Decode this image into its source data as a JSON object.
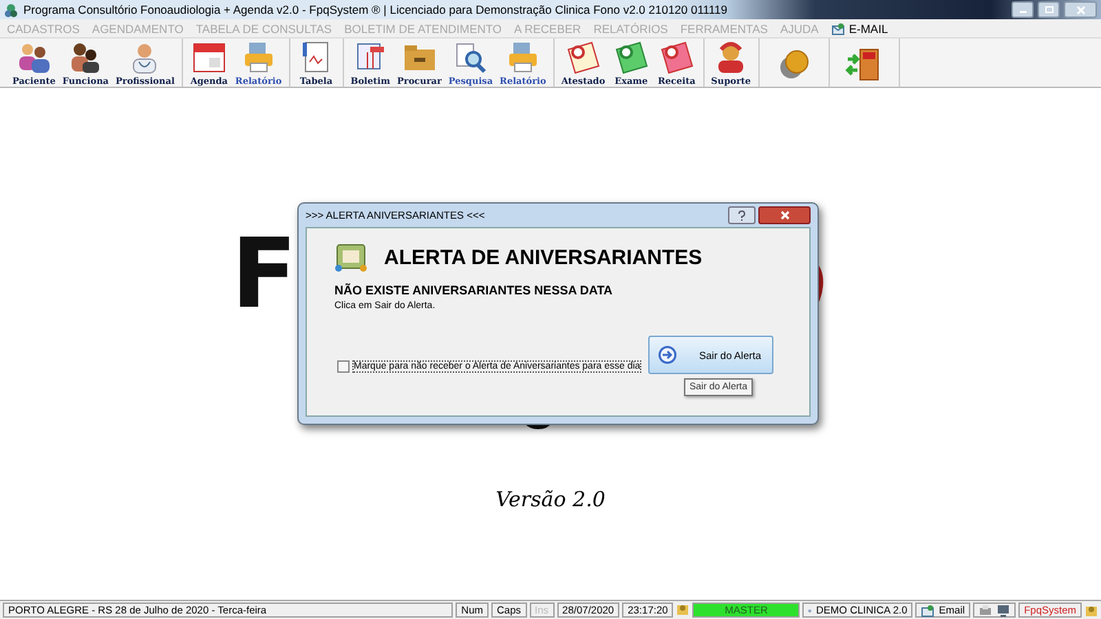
{
  "window": {
    "title": "Programa Consultório Fonoaudiologia + Agenda v2.0 - FpqSystem ® | Licenciado para  Demonstração Clinica Fono v2.0 210120 011119"
  },
  "menu": [
    {
      "label": "CADASTROS",
      "disabled": true
    },
    {
      "label": "AGENDAMENTO",
      "disabled": true
    },
    {
      "label": "TABELA DE CONSULTAS",
      "disabled": true
    },
    {
      "label": "BOLETIM DE ATENDIMENTO",
      "disabled": true
    },
    {
      "label": "A RECEBER",
      "disabled": true
    },
    {
      "label": "RELATÓRIOS",
      "disabled": true
    },
    {
      "label": "FERRAMENTAS",
      "disabled": true
    },
    {
      "label": "AJUDA",
      "disabled": true
    },
    {
      "label": "E-MAIL",
      "disabled": false
    }
  ],
  "toolbar": [
    [
      {
        "label": "Paciente",
        "color": "#10204a"
      },
      {
        "label": "Funciona",
        "color": "#10204a"
      },
      {
        "label": "Profissional",
        "color": "#10204a"
      }
    ],
    [
      {
        "label": "Agenda",
        "color": "#10204a"
      },
      {
        "label": "Relatório",
        "color": "#3050b0"
      }
    ],
    [
      {
        "label": "Tabela",
        "color": "#10204a"
      }
    ],
    [
      {
        "label": "Boletim",
        "color": "#10204a"
      },
      {
        "label": "Procurar",
        "color": "#10204a"
      },
      {
        "label": "Pesquisa",
        "color": "#3050b0"
      },
      {
        "label": "Relatório",
        "color": "#3050b0"
      }
    ],
    [
      {
        "label": "Atestado",
        "color": "#10204a"
      },
      {
        "label": "Exame",
        "color": "#10204a"
      },
      {
        "label": "Receita",
        "color": "#10204a"
      }
    ],
    [
      {
        "label": "Suporte",
        "color": "#10204a"
      }
    ],
    [
      {
        "kind": "icon"
      }
    ],
    [
      {
        "kind": "icon"
      }
    ]
  ],
  "background": {
    "logo_letter": "F",
    "version": "Versão 2.0"
  },
  "dialog": {
    "title": ">>> ALERTA ANIVERSARIANTES <<<",
    "heading": "ALERTA DE ANIVERSARIANTES",
    "message": "NÃO EXISTE ANIVERSARIANTES NESSA DATA",
    "hint": "Clica em Sair do Alerta.",
    "checkbox": {
      "label": "Marque para não receber o Alerta de Aniversariantes para esse dia",
      "checked": false
    },
    "button": "Sair do Alerta",
    "tooltip": "Sair do Alerta"
  },
  "status_bar": {
    "location": "PORTO ALEGRE - RS 28 de Julho de 2020 - Terca-feira",
    "keys": [
      {
        "label": "Num",
        "disabled": false
      },
      {
        "label": "Caps",
        "disabled": false
      },
      {
        "label": "Ins",
        "disabled": true
      }
    ],
    "date": "28/07/2020",
    "time": "23:17:20",
    "user": "MASTER",
    "company": "DEMO CLINICA 2.0",
    "email": "Email",
    "brand": "FpqSystem"
  }
}
